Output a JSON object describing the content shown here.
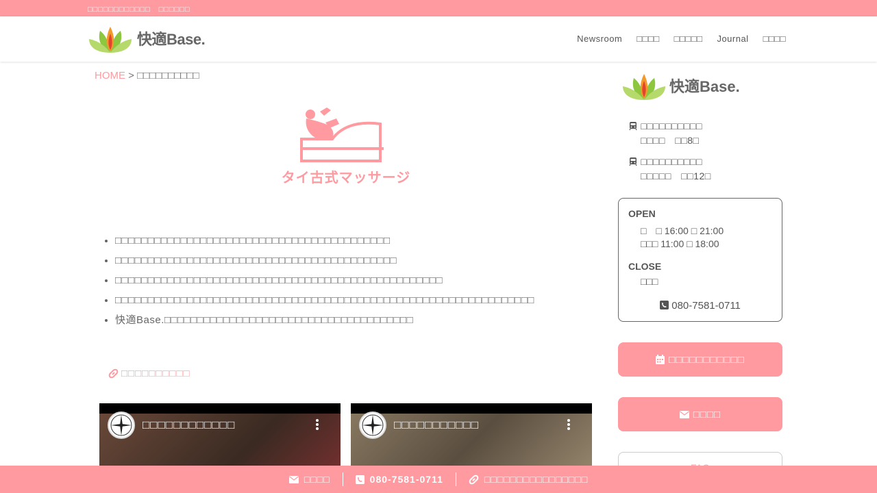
{
  "topbar": {
    "text": "□□□□□□□□□□□□　□□□□□□"
  },
  "header": {
    "brand": "快適Base.",
    "nav": [
      "Newsroom",
      "□□□□",
      "□□□□□",
      "Journal",
      "□□□□"
    ]
  },
  "breadcrumb": {
    "home": "HOME",
    "sep": " > ",
    "current": "□□□□□□□□□□"
  },
  "hero": {
    "label": "タイ古式マッサージ"
  },
  "bullets": [
    "□□□□□□□□□□□□□□□□□□□□□□□□□□□□□□□□□□□□□□□□□□",
    "□□□□□□□□□□□□□□□□□□□□□□□□□□□□□□□□□□□□□□□□□□□",
    "□□□□□□□□□□□□□□□□□□□□□□□□□□□□□□□□□□□□□□□□□□□□□□□□□□",
    "□□□□□□□□□□□□□□□□□□□□□□□□□□□□□□□□□□□□□□□□□□□□□□□□□□□□□□□□□□□□□□□□",
    "快適Base.□□□□□□□□□□□□□□□□□□□□□□□□□□□□□□□□□□□□□□"
  ],
  "extlink": {
    "label": "□□□□□□□□□□"
  },
  "videos": [
    {
      "title": "□□□□□□□□□□□□"
    },
    {
      "title": "□□□□□□□□□□□"
    }
  ],
  "sidebar": {
    "brand": "快適Base.",
    "stations": [
      {
        "line1": "□□□□□□□□□□",
        "line2": "□□□□　□□8□"
      },
      {
        "line1": "□□□□□□□□□□",
        "line2": "□□□□□　□□12□"
      }
    ],
    "hours": {
      "open_label": "OPEN",
      "open_rows": [
        "□　□ 16:00 □ 21:00",
        "□□□ 11:00 □ 18:00"
      ],
      "close_label": "CLOSE",
      "close_rows": [
        "□□□"
      ],
      "tel": "080-7581-0711"
    },
    "reserve_button": "□□□□□□□□□□□",
    "contact_button": "□□□□",
    "faq": "FAQ"
  },
  "footer": {
    "contact": "□□□□",
    "tel": "080-7581-0711",
    "link": "□□□□□□□□□□□□□□□□"
  },
  "colors": {
    "accent": "#ff9aa0",
    "text": "#555555"
  }
}
